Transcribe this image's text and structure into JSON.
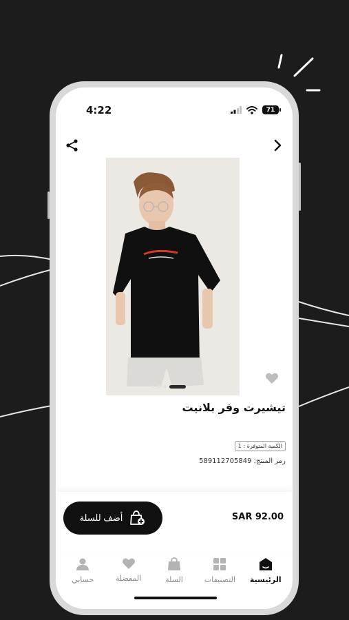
{
  "status_bar": {
    "time": "4:22",
    "battery": "71"
  },
  "product": {
    "title": "تيشيرت وفر بلانيت",
    "available_quantity": "الكمية المتوفرة : 1",
    "sku_label": "رمز المنتج:",
    "sku": "589112705849",
    "image_slides": 4,
    "active_slide": 4
  },
  "cart": {
    "add_button_label": "أضف للسلة",
    "price": "SAR 92.00"
  },
  "tab_bar": {
    "items": [
      {
        "label": "الرئيسية",
        "icon": "home-icon",
        "active": true
      },
      {
        "label": "التصنيفات",
        "icon": "grid-icon",
        "active": false
      },
      {
        "label": "السلة",
        "icon": "cart-icon",
        "active": false
      },
      {
        "label": "المفضلة",
        "icon": "heart-icon",
        "active": false
      },
      {
        "label": "حسابي",
        "icon": "user-icon",
        "active": false
      }
    ]
  },
  "colors": {
    "background": "#1c1c1c",
    "accent": "#111111",
    "inactive": "#b3b3b3"
  }
}
